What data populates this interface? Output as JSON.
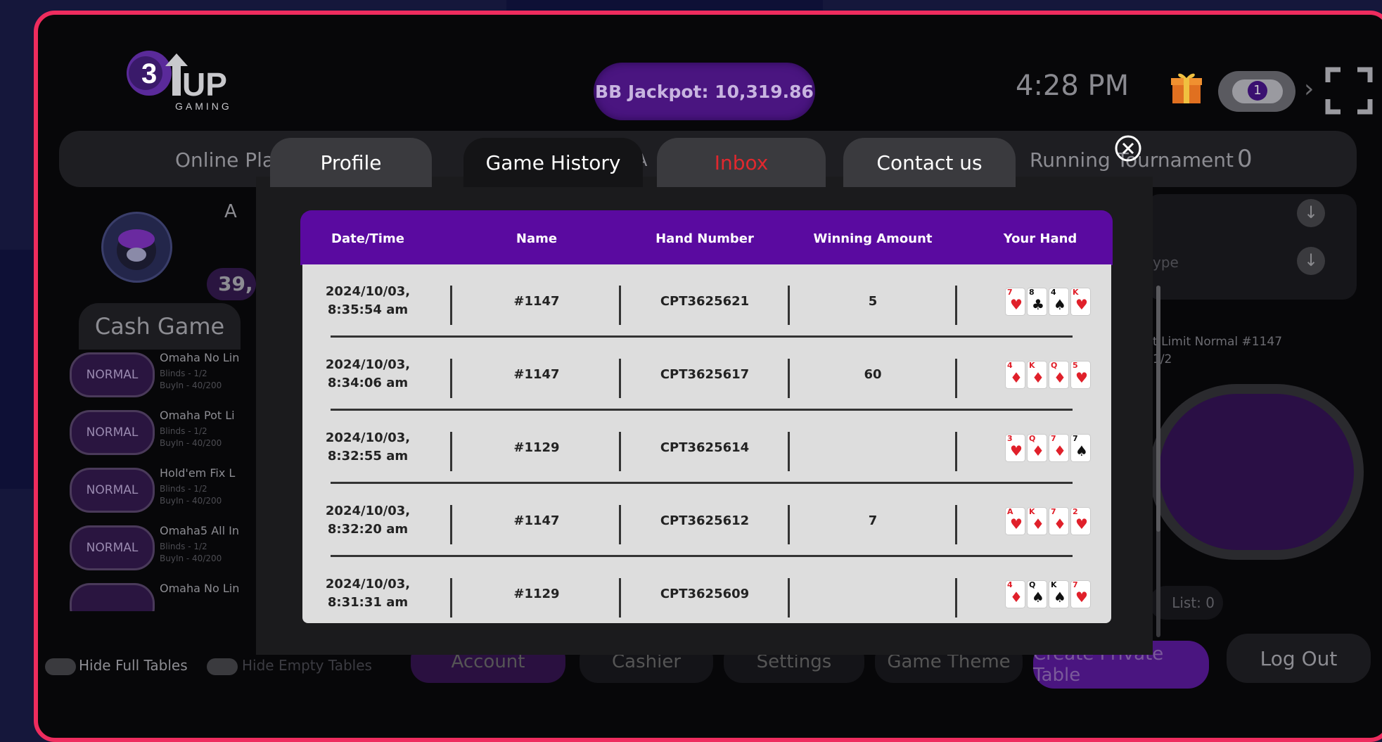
{
  "brand": {
    "logo_number": "3",
    "logo_text": "UP",
    "logo_sub": "GAMING"
  },
  "header": {
    "jackpot": "BB Jackpot: 10,319.86",
    "clock": "4:28 PM",
    "notification_count": "1"
  },
  "lobby": {
    "online_players_label": "Online Pla",
    "hidden_letter_a": "A",
    "running_tournament_label": "Running Tournament",
    "running_tournament_count": "0",
    "balance_partial": "39,",
    "cash_game_tab": "Cash Game",
    "games": [
      {
        "badge": "NORMAL",
        "name": "Omaha No Lin",
        "blinds": "Blinds - 1/2",
        "buyin": "BuyIn - 40/200"
      },
      {
        "badge": "NORMAL",
        "name": "Omaha Pot Li",
        "blinds": "Blinds - 1/2",
        "buyin": "BuyIn - 40/200"
      },
      {
        "badge": "NORMAL",
        "name": "Hold'em Fix L",
        "blinds": "Blinds - 1/2",
        "buyin": "BuyIn - 40/200"
      },
      {
        "badge": "NORMAL",
        "name": "Omaha5 All In",
        "blinds": "Blinds - 1/2",
        "buyin": "BuyIn - 40/200"
      },
      {
        "badge": "",
        "name": "Omaha No Lin",
        "blinds": "",
        "buyin": ""
      }
    ],
    "right_type_label": "ype",
    "right_table_name": "t Limit Normal #1147",
    "right_table_blinds": "1/2",
    "waiting_list": "List: 0",
    "bottom": {
      "hide_full_tables": "Hide Full Tables",
      "hide_empty_tables": "Hide Empty Tables",
      "account": "Account",
      "cashier": "Cashier",
      "settings": "Settings",
      "game_theme": "Game Theme",
      "create_private_table": "Create Private Table",
      "log_out": "Log Out"
    }
  },
  "modal": {
    "tabs": [
      {
        "label": "Profile"
      },
      {
        "label": "Game History"
      },
      {
        "label": "Inbox"
      },
      {
        "label": "Contact us"
      }
    ],
    "active_tab": "Game History",
    "columns": [
      "Date/Time",
      "Name",
      "Hand Number",
      "Winning Amount",
      "Your Hand"
    ],
    "rows": [
      {
        "date": "2024/10/03,",
        "time": "8:35:54 am",
        "name": "#1147",
        "hand_number": "CPT3625621",
        "winning": "5",
        "cards": [
          {
            "r": "7",
            "s": "♥",
            "c": "red"
          },
          {
            "r": "8",
            "s": "♣",
            "c": "blk"
          },
          {
            "r": "4",
            "s": "♠",
            "c": "blk"
          },
          {
            "r": "K",
            "s": "♥",
            "c": "red"
          }
        ]
      },
      {
        "date": "2024/10/03,",
        "time": "8:34:06 am",
        "name": "#1147",
        "hand_number": "CPT3625617",
        "winning": "60",
        "cards": [
          {
            "r": "4",
            "s": "♦",
            "c": "red"
          },
          {
            "r": "K",
            "s": "♦",
            "c": "red"
          },
          {
            "r": "Q",
            "s": "♦",
            "c": "red"
          },
          {
            "r": "5",
            "s": "♥",
            "c": "red"
          }
        ]
      },
      {
        "date": "2024/10/03,",
        "time": "8:32:55 am",
        "name": "#1129",
        "hand_number": "CPT3625614",
        "winning": "",
        "cards": [
          {
            "r": "3",
            "s": "♥",
            "c": "red"
          },
          {
            "r": "Q",
            "s": "♦",
            "c": "red"
          },
          {
            "r": "7",
            "s": "♦",
            "c": "red"
          },
          {
            "r": "7",
            "s": "♠",
            "c": "blk"
          }
        ]
      },
      {
        "date": "2024/10/03,",
        "time": "8:32:20 am",
        "name": "#1147",
        "hand_number": "CPT3625612",
        "winning": "7",
        "cards": [
          {
            "r": "A",
            "s": "♥",
            "c": "red"
          },
          {
            "r": "K",
            "s": "♦",
            "c": "red"
          },
          {
            "r": "7",
            "s": "♦",
            "c": "red"
          },
          {
            "r": "2",
            "s": "♥",
            "c": "red"
          }
        ]
      },
      {
        "date": "2024/10/03,",
        "time": "8:31:31 am",
        "name": "#1129",
        "hand_number": "CPT3625609",
        "winning": "",
        "cards": [
          {
            "r": "4",
            "s": "♦",
            "c": "red"
          },
          {
            "r": "Q",
            "s": "♠",
            "c": "blk"
          },
          {
            "r": "K",
            "s": "♠",
            "c": "blk"
          },
          {
            "r": "7",
            "s": "♥",
            "c": "red"
          }
        ]
      }
    ]
  },
  "colors": {
    "frame": "#ee2c5e",
    "header_purple": "#5a0aa0",
    "inbox_red": "#e0282e"
  }
}
